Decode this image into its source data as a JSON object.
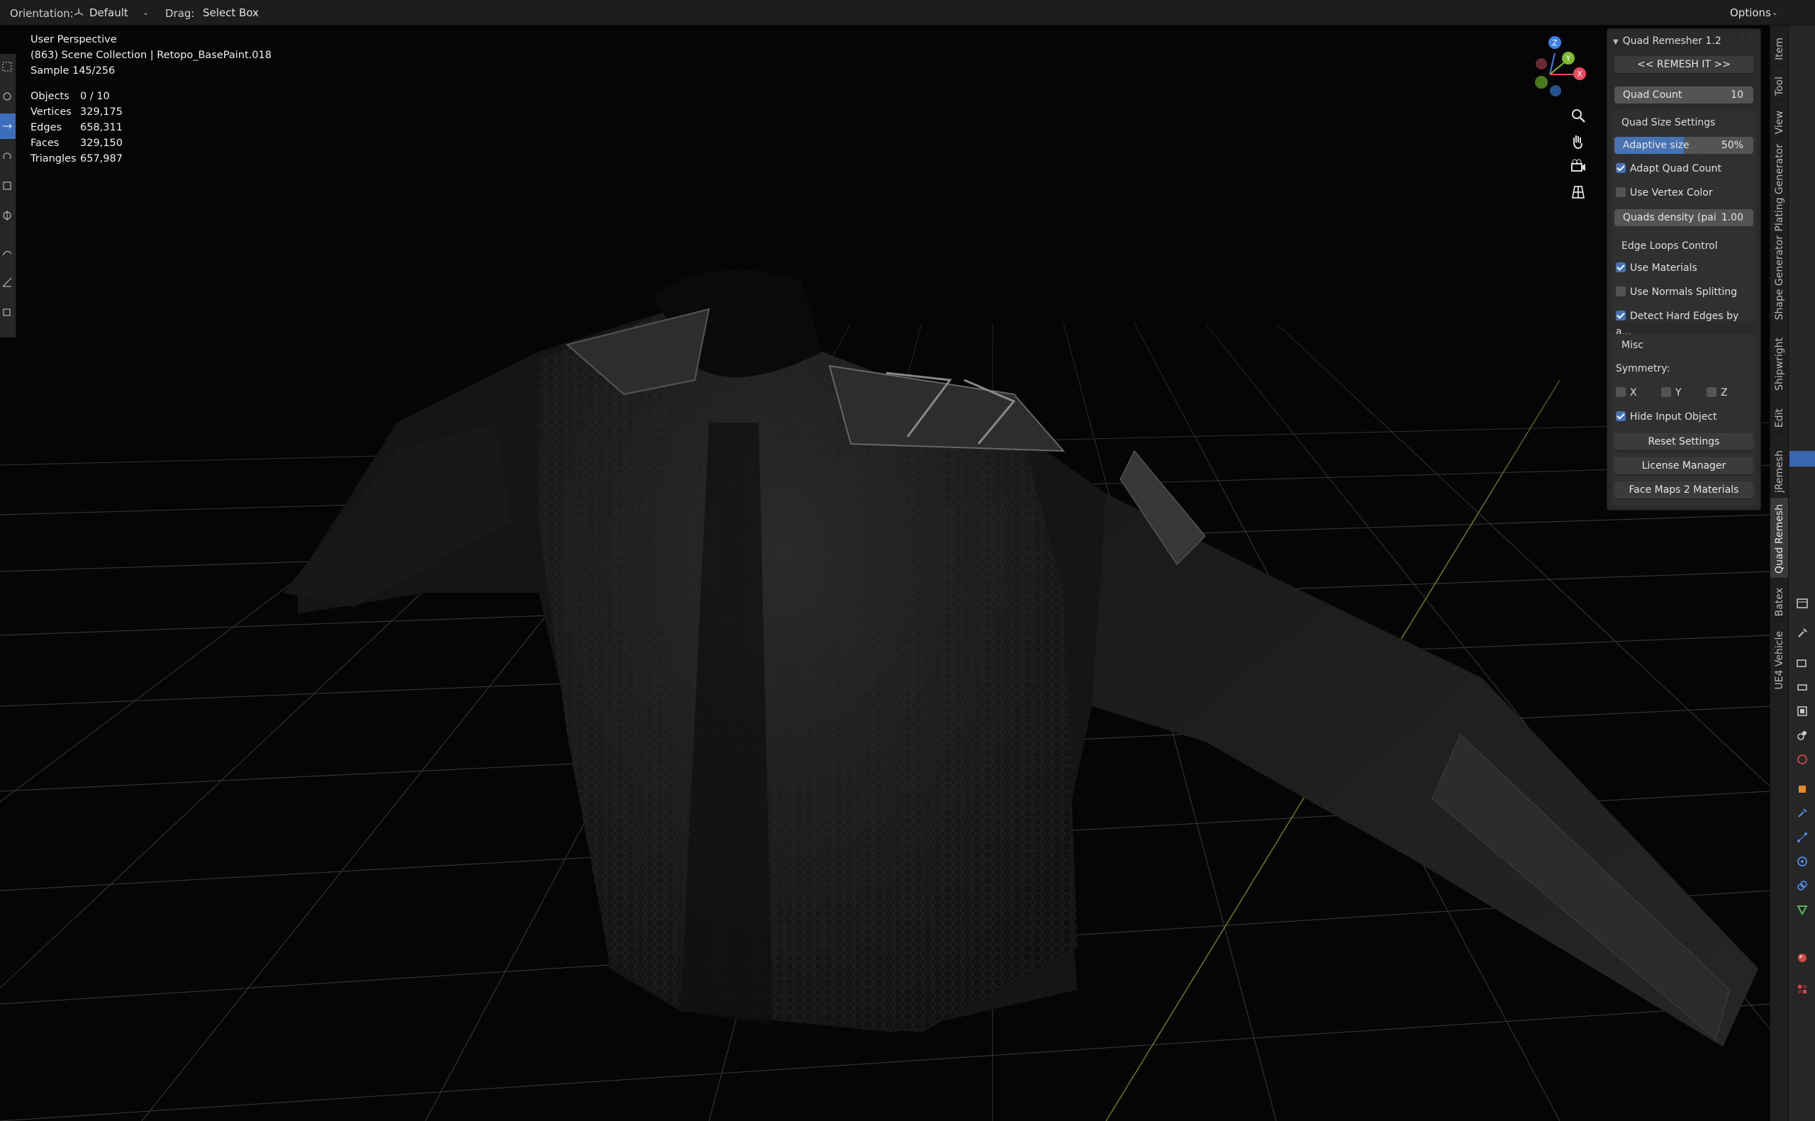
{
  "header": {
    "orientation_label": "Orientation:",
    "orientation_value": "Default",
    "drag_label": "Drag:",
    "drag_value": "Select Box",
    "options_label": "Options"
  },
  "viewport_info": {
    "perspective": "User Perspective",
    "collection": "(863) Scene Collection | Retopo_BasePaint.018",
    "sample": "Sample 145/256"
  },
  "stats": [
    {
      "label": "Objects",
      "value": "0 / 10"
    },
    {
      "label": "Vertices",
      "value": "329,175"
    },
    {
      "label": "Edges",
      "value": "658,311"
    },
    {
      "label": "Faces",
      "value": "329,150"
    },
    {
      "label": "Triangles",
      "value": "657,987"
    }
  ],
  "gizmo": {
    "z": "Z",
    "y": "Y",
    "x": "X"
  },
  "panel": {
    "title": "Quad Remesher 1.2",
    "remesh_button": "<< REMESH IT >>",
    "quad_count_label": "Quad Count",
    "quad_count_value": "10",
    "quad_size_title": "Quad Size Settings",
    "adaptive_label": "Adaptive size",
    "adaptive_value": "50%",
    "adaptive_fraction": 0.5,
    "adapt_quad_count": "Adapt Quad Count",
    "use_vertex_color": "Use Vertex Color",
    "quads_density_label": "Quads density (pai",
    "quads_density_value": "1.00",
    "edge_loops_title": "Edge Loops Control",
    "use_materials": "Use Materials",
    "use_normals_splitting": "Use Normals Splitting",
    "detect_hard_edges": "Detect Hard Edges by a...",
    "misc_title": "Misc",
    "symmetry_label": "Symmetry:",
    "sym_x": "X",
    "sym_y": "Y",
    "sym_z": "Z",
    "hide_input_object": "Hide Input Object",
    "reset_settings": "Reset Settings",
    "license_manager": "License Manager",
    "face_maps_materials": "Face Maps 2 Materials"
  },
  "checkbox_states": {
    "adapt_quad_count": true,
    "use_vertex_color": false,
    "use_materials": true,
    "use_normals_splitting": false,
    "detect_hard_edges": true,
    "sym_x": false,
    "sym_y": false,
    "sym_z": false,
    "hide_input_object": true
  },
  "vertical_tabs": [
    "Item",
    "Tool",
    "View",
    "Plating Generator",
    "Shape Generator",
    "Shipwright",
    "Edit",
    "jRemesh",
    "Quad Remesh",
    "Batex",
    "UE4 Vehicle"
  ],
  "colors": {
    "accent": "#4772b3",
    "panel_bg": "#2a2a2a",
    "gizmo_x": "#e84a5f",
    "gizmo_y": "#7cba2f",
    "gizmo_z": "#3b82e8"
  }
}
